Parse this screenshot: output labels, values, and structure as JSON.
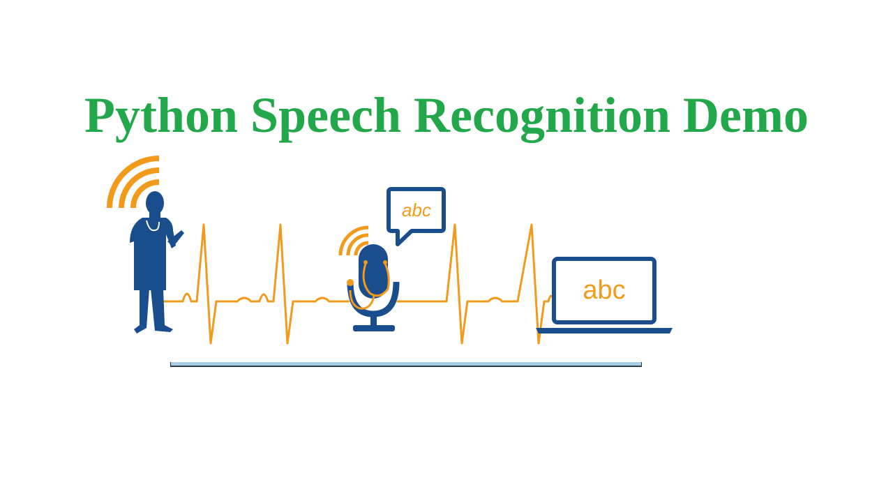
{
  "window": {
    "title": "Python Speech Recognition Demo"
  },
  "illustration": {
    "bubble_text": "abc",
    "laptop_text": "abc",
    "icons": [
      "doctor-icon",
      "signal-waves-icon",
      "microphone-icon",
      "stethoscope-icon",
      "speech-bubble-icon",
      "laptop-icon",
      "heartbeat-line"
    ]
  },
  "progress": {
    "value": 1.0
  },
  "colors": {
    "title": "#22a84a",
    "navy": "#1a4d8c",
    "orange": "#f29a1c",
    "progress_fill": "#a9cde6"
  }
}
